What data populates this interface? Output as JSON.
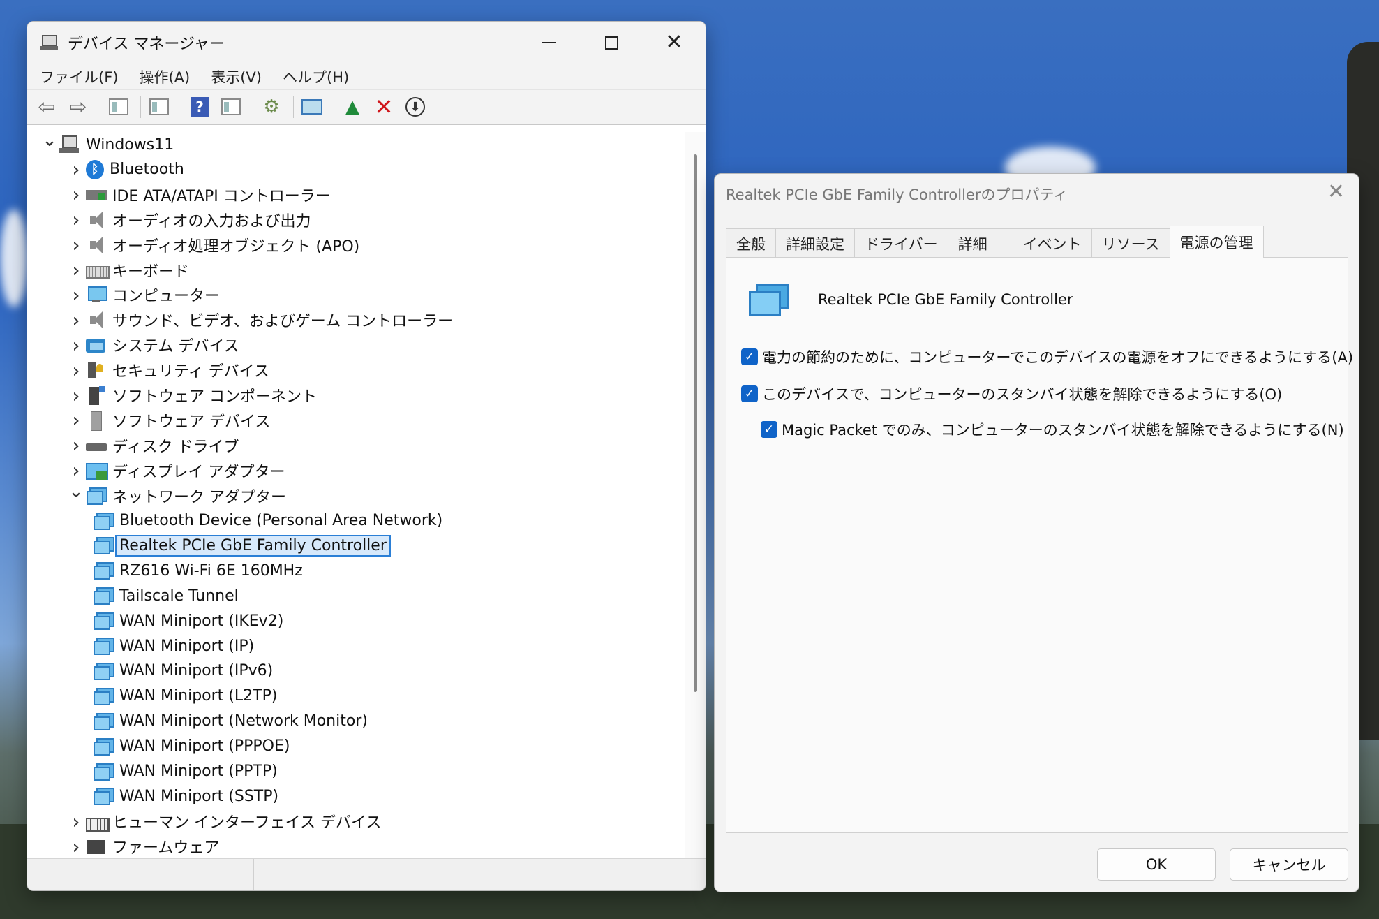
{
  "device_manager": {
    "title": "デバイス マネージャー",
    "window_buttons": {
      "minimize": "—",
      "maximize": "□",
      "close": "✕"
    },
    "menu": [
      "ファイル(F)",
      "操作(A)",
      "表示(V)",
      "ヘルプ(H)"
    ],
    "tree": {
      "root": "Windows11",
      "categories": [
        "Bluetooth",
        "IDE ATA/ATAPI コントローラー",
        "オーディオの入力および出力",
        "オーディオ処理オブジェクト (APO)",
        "キーボード",
        "コンピューター",
        "サウンド、ビデオ、およびゲーム コントローラー",
        "システム デバイス",
        "セキュリティ デバイス",
        "ソフトウェア コンポーネント",
        "ソフトウェア デバイス",
        "ディスク ドライブ",
        "ディスプレイ アダプター",
        "ネットワーク アダプター"
      ],
      "network_adapters": [
        "Bluetooth Device (Personal Area Network)",
        "Realtek PCIe GbE Family Controller",
        "RZ616 Wi-Fi 6E 160MHz",
        "Tailscale Tunnel",
        "WAN Miniport (IKEv2)",
        "WAN Miniport (IP)",
        "WAN Miniport (IPv6)",
        "WAN Miniport (L2TP)",
        "WAN Miniport (Network Monitor)",
        "WAN Miniport (PPPOE)",
        "WAN Miniport (PPTP)",
        "WAN Miniport (SSTP)"
      ],
      "after": [
        "ヒューマン インターフェイス デバイス",
        "ファームウェア"
      ],
      "selected": "Realtek PCIe GbE Family Controller"
    }
  },
  "properties": {
    "title": "Realtek PCIe GbE Family Controllerのプロパティ",
    "close": "✕",
    "tabs": [
      "全般",
      "詳細設定",
      "ドライバー",
      "詳細",
      "イベント",
      "リソース",
      "電源の管理"
    ],
    "active_tab": "電源の管理",
    "device_name": "Realtek PCIe GbE Family Controller",
    "options": [
      {
        "label": "電力の節約のために、コンピューターでこのデバイスの電源をオフにできるようにする(A)",
        "checked": true
      },
      {
        "label": "このデバイスで、コンピューターのスタンバイ状態を解除できるようにする(O)",
        "checked": true
      },
      {
        "label": "Magic Packet でのみ、コンピューターのスタンバイ状態を解除できるようにする(N)",
        "checked": true
      }
    ],
    "ok": "OK",
    "cancel": "キャンセル"
  },
  "colors": {
    "accent": "#0f63c8",
    "selection_border": "#2b7fd6",
    "selection_bg": "#d7e9fb",
    "delete_red": "#d0161b"
  }
}
